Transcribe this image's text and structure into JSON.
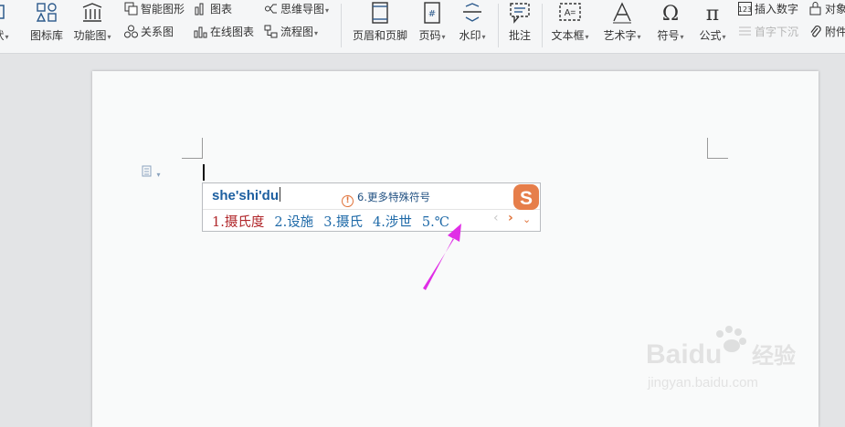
{
  "ribbon": {
    "col1": {
      "shape_partial": "状",
      "icon_lib": "图标库",
      "func_chart": "功能图"
    },
    "col2": {
      "smart_art": "智能图形",
      "relation": "关系图",
      "chart": "图表",
      "online_chart": "在线图表"
    },
    "col3": {
      "mindmap": "思维导图",
      "flowchart": "流程图"
    },
    "col4": {
      "header_footer": "页眉和页脚",
      "page_no": "页码",
      "watermark": "水印"
    },
    "col5": {
      "comment": "批注"
    },
    "col6": {
      "textbox": "文本框",
      "wordart": "艺术字",
      "symbol": "符号",
      "formula": "公式"
    },
    "col7": {
      "insert_number": "插入数字",
      "dropcap": "首字下沉",
      "object": "对象",
      "attachment": "附件"
    }
  },
  "ime": {
    "pinyin": "she'shi'du",
    "hint_num": "6.",
    "hint_text": "更多特殊符号",
    "candidates": [
      {
        "num": "1.",
        "text": "摄氏度"
      },
      {
        "num": "2.",
        "text": "设施"
      },
      {
        "num": "3.",
        "text": "摄氏"
      },
      {
        "num": "4.",
        "text": "涉世"
      },
      {
        "num": "5.",
        "text": "℃"
      }
    ]
  },
  "watermark": {
    "brand": "Baidu",
    "jingyan": "经验",
    "url": "jingyan.baidu.com"
  },
  "colors": {
    "candidate_first": "#b0262a",
    "candidate": "#1f6aa8",
    "arrow": "#e02ee6",
    "sogou": "#e67e4a"
  }
}
